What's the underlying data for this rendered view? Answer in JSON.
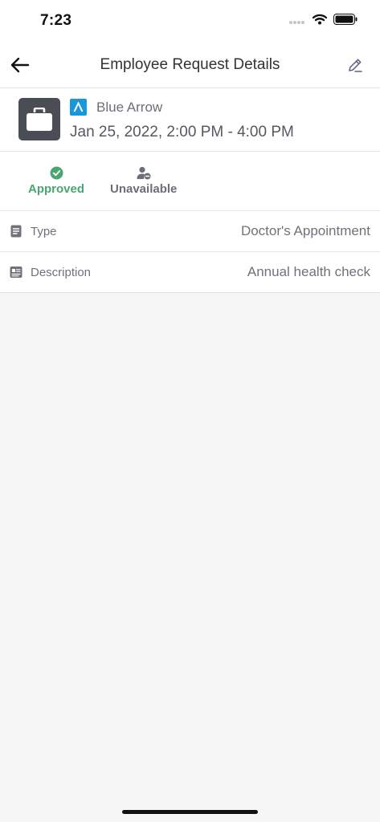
{
  "status_bar": {
    "time": "7:23",
    "icons": [
      "cellular-dots-icon",
      "wifi-icon",
      "battery-icon"
    ]
  },
  "nav": {
    "title": "Employee Request Details",
    "back_icon": "arrow-left-icon",
    "edit_icon": "pencil-icon"
  },
  "request": {
    "category_icon": "briefcase-icon",
    "organization": "Blue Arrow",
    "organization_logo": "blue-arrow-logo",
    "date_range": "Jan 25, 2022, 2:00 PM - 4:00 PM"
  },
  "statuses": [
    {
      "label": "Approved",
      "icon": "check-circle-icon",
      "color": "#4aa56f"
    },
    {
      "label": "Unavailable",
      "icon": "person-unavailable-icon",
      "color": "#6b6e77"
    }
  ],
  "details": [
    {
      "label": "Type",
      "value": "Doctor's Appointment",
      "icon": "document-icon"
    },
    {
      "label": "Description",
      "value": "Annual health check",
      "icon": "description-icon"
    }
  ],
  "colors": {
    "brand_blue": "#1a97d8",
    "approved_green": "#4aa56f",
    "background": "#f6f6f6",
    "category_box": "#4a4d55"
  }
}
